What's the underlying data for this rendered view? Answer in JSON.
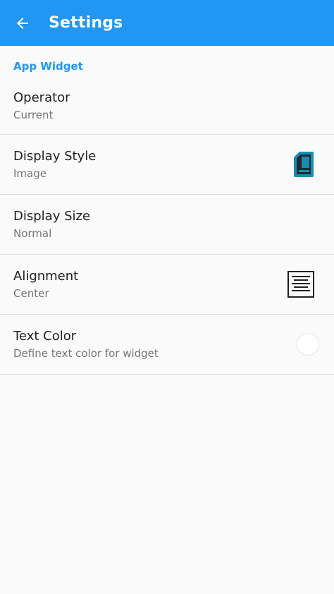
{
  "toolbar": {
    "title": "Settings",
    "back_icon": "arrow-back-icon",
    "background": "#2196f3"
  },
  "section": {
    "header": "App Widget"
  },
  "preferences": [
    {
      "title": "Operator",
      "summary": "Current"
    },
    {
      "title": "Display Style",
      "summary": "Image",
      "icon": "sim-card-icon"
    },
    {
      "title": "Display Size",
      "summary": "Normal"
    },
    {
      "title": "Alignment",
      "summary": "Center",
      "icon": "align-center-icon"
    },
    {
      "title": "Text Color",
      "summary": "Define text color for widget",
      "color": "#ffffff"
    }
  ],
  "colors": {
    "accent": "#2196f3",
    "sim_icon": "#1a8cb0",
    "title_text": "#212121",
    "summary_text": "#757575"
  }
}
